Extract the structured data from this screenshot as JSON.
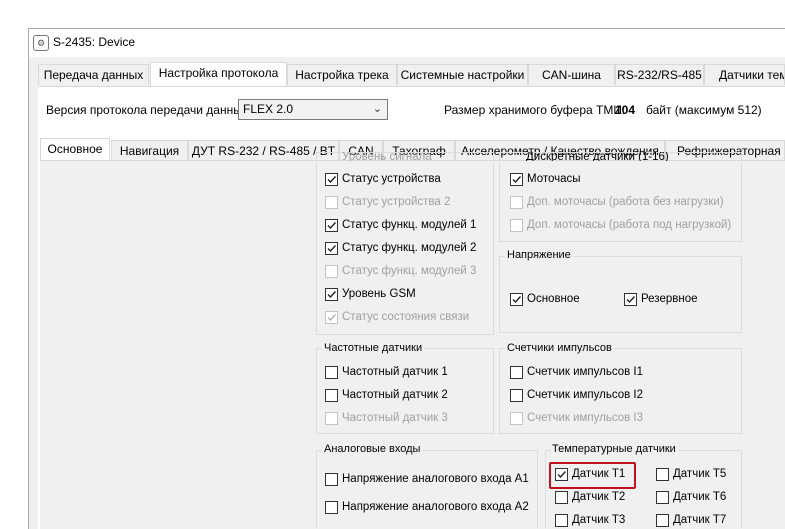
{
  "window": {
    "title": "S-2435: Device",
    "icon": "app-icon"
  },
  "main_tabs": [
    "Передача данных",
    "Настройка протокола",
    "Настройка трека",
    "Системные настройки",
    "CAN-шина",
    "RS-232/RS-485",
    "Датчики тем"
  ],
  "protocol": {
    "version_label": "Версия протокола передачи данных",
    "version_value": "FLEX 2.0"
  },
  "buffer": {
    "label": "Размер хранимого буфера ТМИ:",
    "value": "104",
    "suffix": "байт (максимум 512)"
  },
  "sub_tabs": [
    "Основное",
    "Навигация",
    "ДУТ RS-232 / RS-485 / BT",
    "CAN",
    "Тахограф",
    "Акселерометр / Качество вождения",
    "Рефрижераторная ус"
  ],
  "status_group": {
    "cut_label": "Уровень сигнала",
    "items": [
      {
        "label": "Статус устройства",
        "checked": true,
        "enabled": true
      },
      {
        "label": "Статус устройства 2",
        "checked": false,
        "enabled": false
      },
      {
        "label": "Статус функц. модулей 1",
        "checked": true,
        "enabled": true
      },
      {
        "label": "Статус функц. модулей 2",
        "checked": true,
        "enabled": true
      },
      {
        "label": "Статус функц. модулей 3",
        "checked": false,
        "enabled": false
      },
      {
        "label": "Уровень GSM",
        "checked": true,
        "enabled": true
      },
      {
        "label": "Статус состояния связи",
        "checked": true,
        "enabled": false
      }
    ]
  },
  "motor_group": {
    "cut_label": "Дискретные датчики (1-16)",
    "items": [
      {
        "label": "Моточасы",
        "checked": true,
        "enabled": true
      },
      {
        "label": "Доп. моточасы (работа без нагрузки)",
        "checked": false,
        "enabled": false
      },
      {
        "label": "Доп. моточасы (работа под нагрузкой)",
        "checked": false,
        "enabled": false
      }
    ]
  },
  "voltage_group": {
    "title": "Напряжение",
    "items": [
      {
        "label": "Основное",
        "checked": true,
        "enabled": true
      },
      {
        "label": "Резервное",
        "checked": true,
        "enabled": true
      }
    ]
  },
  "freq_group": {
    "title": "Частотные датчики",
    "items": [
      {
        "label": "Частотный датчик 1",
        "checked": false,
        "enabled": true
      },
      {
        "label": "Частотный датчик 2",
        "checked": false,
        "enabled": true
      },
      {
        "label": "Частотный датчик 3",
        "checked": false,
        "enabled": false
      }
    ]
  },
  "pulse_group": {
    "title": "Счетчики импульсов",
    "items": [
      {
        "label": "Счетчик импульсов I1",
        "checked": false,
        "enabled": true
      },
      {
        "label": "Счетчик импульсов I2",
        "checked": false,
        "enabled": true
      },
      {
        "label": "Счетчик импульсов I3",
        "checked": false,
        "enabled": false
      }
    ]
  },
  "analog_group": {
    "title": "Аналоговые входы",
    "items": [
      {
        "label": "Напряжение аналогового входа A1",
        "checked": false,
        "enabled": true
      },
      {
        "label": "Напряжение аналогового входа A2",
        "checked": false,
        "enabled": true
      }
    ]
  },
  "temp_group": {
    "title": "Температурные датчики",
    "items": [
      {
        "label": "Датчик T1",
        "checked": true,
        "enabled": true
      },
      {
        "label": "Датчик T5",
        "checked": false,
        "enabled": true
      },
      {
        "label": "Датчик T2",
        "checked": false,
        "enabled": true
      },
      {
        "label": "Датчик T6",
        "checked": false,
        "enabled": true
      },
      {
        "label": "Датчик T3",
        "checked": false,
        "enabled": true
      },
      {
        "label": "Датчик T7",
        "checked": false,
        "enabled": true
      }
    ]
  },
  "colors": {
    "highlight": "#c0121d"
  }
}
